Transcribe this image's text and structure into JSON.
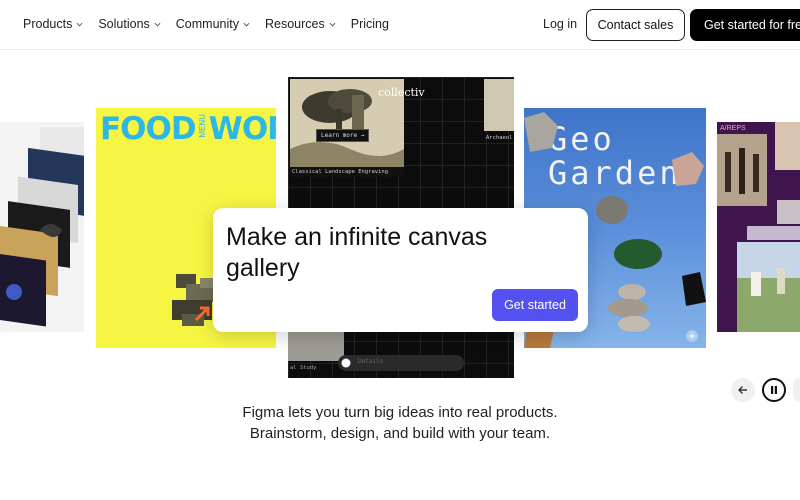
{
  "nav": {
    "items": [
      {
        "label": "Products",
        "has_dropdown": true
      },
      {
        "label": "Solutions",
        "has_dropdown": true
      },
      {
        "label": "Community",
        "has_dropdown": true
      },
      {
        "label": "Resources",
        "has_dropdown": true
      },
      {
        "label": "Pricing",
        "has_dropdown": false
      }
    ],
    "login": "Log in",
    "contact_sales": "Contact sales",
    "get_started": "Get started for free"
  },
  "gallery": {
    "food_card": {
      "title_left": "FOOD",
      "title_mid": "MENU",
      "title_right": "WORKS"
    },
    "collectiv_card": {
      "brand": "collectiv",
      "tag1": "Learn more →",
      "tag2": "Classical Landscape Engraving",
      "tag3": "Archaeol",
      "tag4": "al Study",
      "tag5": "Details"
    },
    "geo_card": {
      "line1": "Geo",
      "line2": "Garden"
    },
    "reps_card": {
      "brand": "A/REPS"
    }
  },
  "cta": {
    "title": "Make an infinite canvas gallery",
    "button": "Get started"
  },
  "tagline": {
    "line1": "Figma lets you turn big ideas into real products.",
    "line2": "Brainstorm, design, and build with your team."
  },
  "colors": {
    "accent": "#5451f1",
    "food_bg": "#f6f544",
    "food_title": "#2bb8e6",
    "reps_bg": "#40154e"
  }
}
